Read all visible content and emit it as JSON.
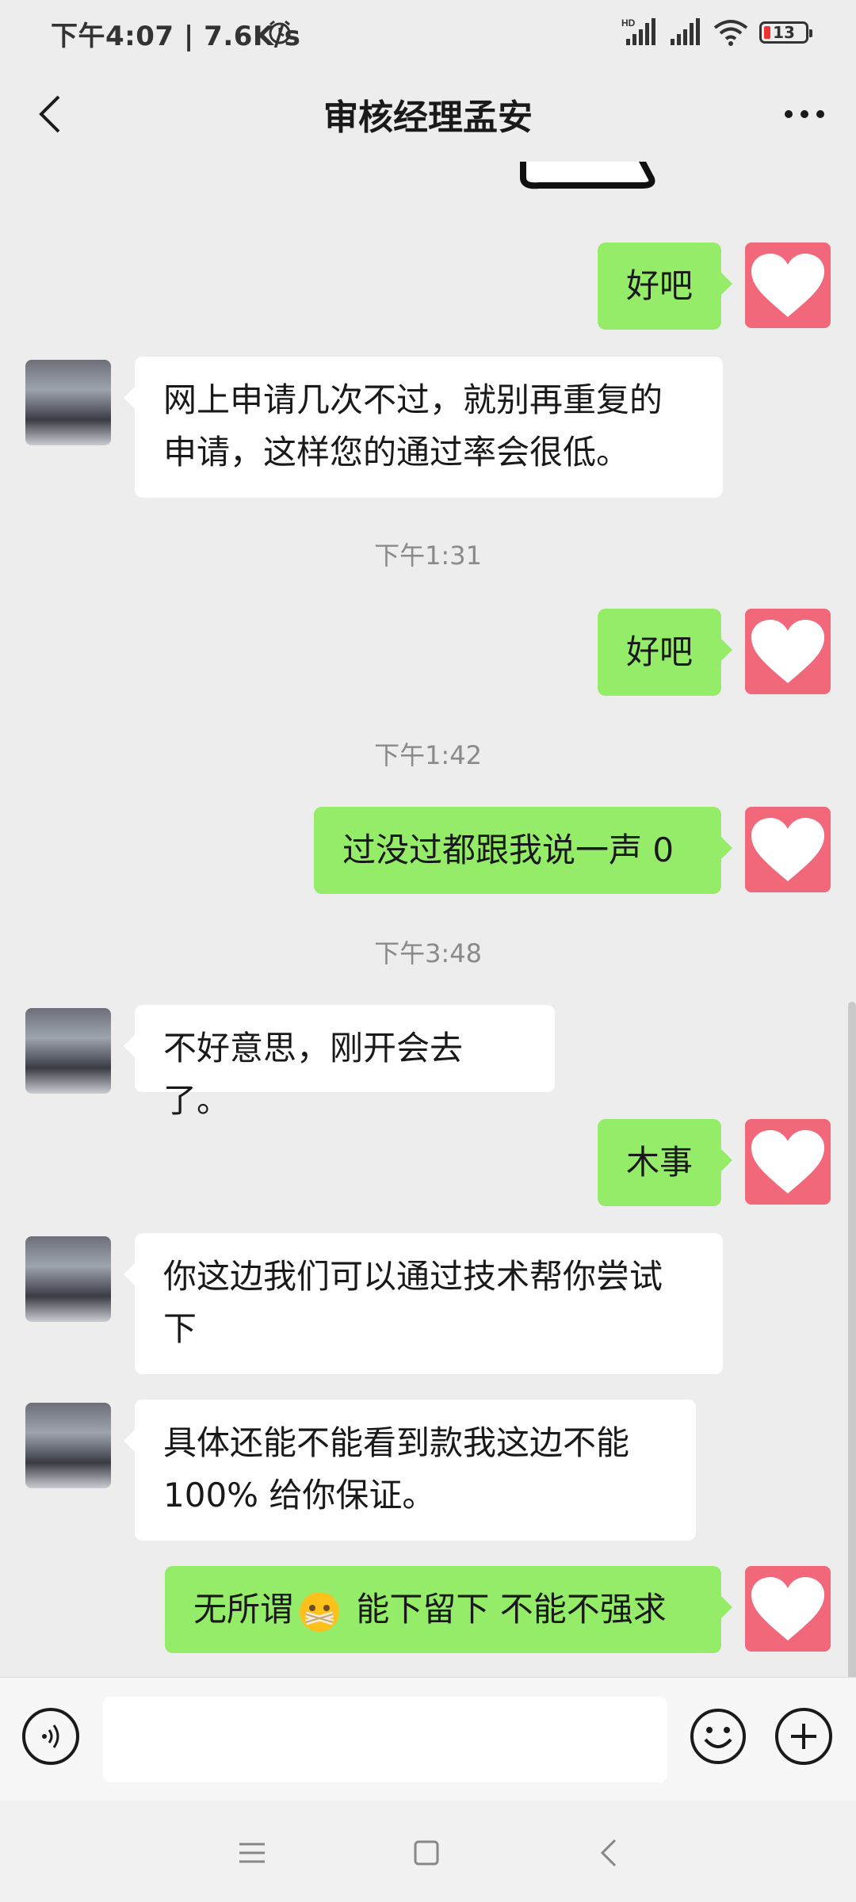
{
  "status_bar": {
    "left_text": "下午4:07 | 7.6K/s",
    "battery_level": "13",
    "icons": [
      "alarm-icon",
      "hd-signal-icon",
      "signal-icon",
      "wifi-icon",
      "battery-icon"
    ]
  },
  "header": {
    "title": "审核经理孟安",
    "back_icon": "chevron-left-icon",
    "more_icon": "more-dots-icon"
  },
  "messages": [
    {
      "type": "out",
      "text": "好吧"
    },
    {
      "type": "in",
      "lines": [
        "网上申请几次不过，就别再重复的",
        "申请，这样您的通过率会很低。"
      ]
    },
    {
      "type": "time",
      "text": "下午1:31"
    },
    {
      "type": "out",
      "text": "好吧"
    },
    {
      "type": "time",
      "text": "下午1:42"
    },
    {
      "type": "out",
      "text": "过没过都跟我说一声 0"
    },
    {
      "type": "time",
      "text": "下午3:48"
    },
    {
      "type": "in",
      "text": "不好意思，刚开会去了。"
    },
    {
      "type": "out",
      "text": "木事"
    },
    {
      "type": "in",
      "lines": [
        "你这边我们可以通过技术帮你尝试",
        "下"
      ]
    },
    {
      "type": "in",
      "lines": [
        "具体还能不能看到款我这边不能",
        "100% 给你保证。"
      ]
    },
    {
      "type": "out",
      "text_before": "无所谓",
      "emoji": "zipper-mouth-emoji",
      "text_after": " 能下留下 不能不强求"
    }
  ],
  "input_bar": {
    "placeholder": "",
    "voice_icon": "voice-icon",
    "emoji_icon": "smiley-icon",
    "plus_icon": "plus-icon"
  },
  "nav_bar": {
    "icons": [
      "menu-icon",
      "home-square-icon",
      "back-triangle-icon"
    ]
  },
  "colors": {
    "background": "#ededed",
    "outgoing_bubble": "#95ec69",
    "incoming_bubble": "#ffffff",
    "self_avatar": "#f0687a"
  }
}
